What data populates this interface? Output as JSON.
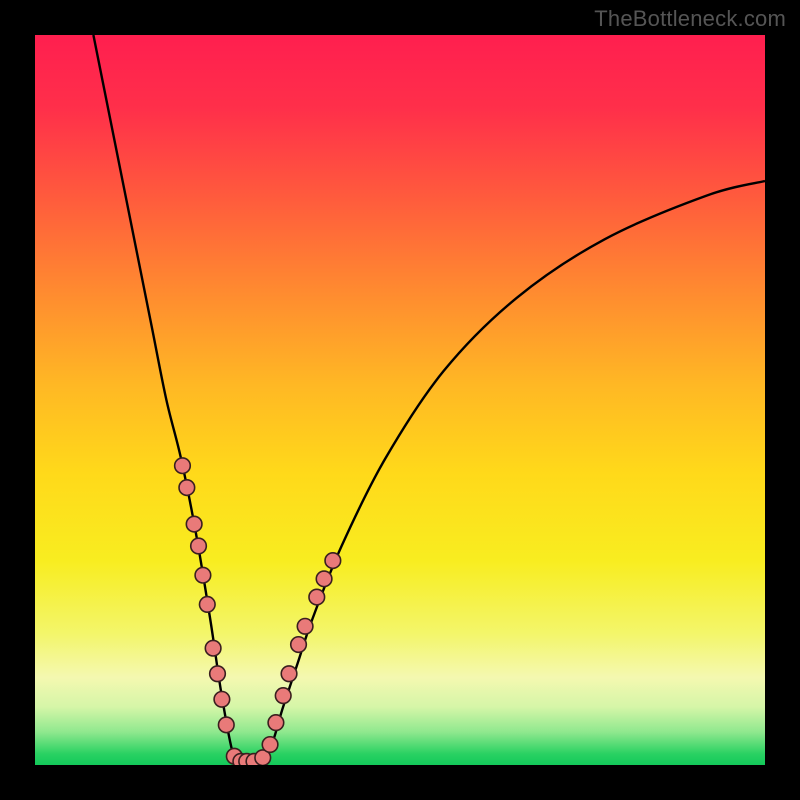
{
  "watermark": "TheBottleneck.com",
  "chart_data": {
    "type": "line",
    "title": "",
    "xlabel": "",
    "ylabel": "",
    "xlim": [
      0,
      100
    ],
    "ylim": [
      0,
      100
    ],
    "series": [
      {
        "name": "bottleneck-curve",
        "x": [
          8,
          10,
          12,
          14,
          16,
          18,
          20,
          22,
          24,
          25.5,
          27,
          28,
          29,
          32,
          34,
          36,
          38,
          42,
          48,
          56,
          66,
          78,
          92,
          100
        ],
        "y": [
          100,
          90,
          80,
          70,
          60,
          50,
          42,
          32,
          20,
          10,
          2,
          0,
          0,
          2,
          8,
          14,
          20,
          30,
          42,
          54,
          64,
          72,
          78,
          80
        ]
      }
    ],
    "markers": [
      {
        "x": 20.2,
        "y": 41
      },
      {
        "x": 20.8,
        "y": 38
      },
      {
        "x": 21.8,
        "y": 33
      },
      {
        "x": 22.4,
        "y": 30
      },
      {
        "x": 23.0,
        "y": 26
      },
      {
        "x": 23.6,
        "y": 22
      },
      {
        "x": 24.4,
        "y": 16
      },
      {
        "x": 25.0,
        "y": 12.5
      },
      {
        "x": 25.6,
        "y": 9
      },
      {
        "x": 26.2,
        "y": 5.5
      },
      {
        "x": 27.3,
        "y": 1.2
      },
      {
        "x": 28.2,
        "y": 0.5
      },
      {
        "x": 29.0,
        "y": 0.5
      },
      {
        "x": 30.0,
        "y": 0.5
      },
      {
        "x": 31.2,
        "y": 1.0
      },
      {
        "x": 32.2,
        "y": 2.8
      },
      {
        "x": 33.0,
        "y": 5.8
      },
      {
        "x": 34.0,
        "y": 9.5
      },
      {
        "x": 34.8,
        "y": 12.5
      },
      {
        "x": 36.1,
        "y": 16.5
      },
      {
        "x": 37.0,
        "y": 19.0
      },
      {
        "x": 38.6,
        "y": 23.0
      },
      {
        "x": 39.6,
        "y": 25.5
      },
      {
        "x": 40.8,
        "y": 28.0
      }
    ],
    "gradient_stops": [
      {
        "offset": 0.0,
        "color": "#ff1f4f"
      },
      {
        "offset": 0.1,
        "color": "#ff2f4a"
      },
      {
        "offset": 0.22,
        "color": "#ff5a3d"
      },
      {
        "offset": 0.35,
        "color": "#ff8a30"
      },
      {
        "offset": 0.48,
        "color": "#ffb824"
      },
      {
        "offset": 0.6,
        "color": "#ffd91a"
      },
      {
        "offset": 0.72,
        "color": "#f8ed20"
      },
      {
        "offset": 0.82,
        "color": "#f3f66a"
      },
      {
        "offset": 0.88,
        "color": "#f4f8b0"
      },
      {
        "offset": 0.92,
        "color": "#d6f6a8"
      },
      {
        "offset": 0.955,
        "color": "#8fe88e"
      },
      {
        "offset": 0.985,
        "color": "#29d162"
      },
      {
        "offset": 1.0,
        "color": "#13c95a"
      }
    ],
    "marker_color": "#e97a79",
    "marker_stroke": "#3a1f1f",
    "curve_color": "#000000"
  }
}
